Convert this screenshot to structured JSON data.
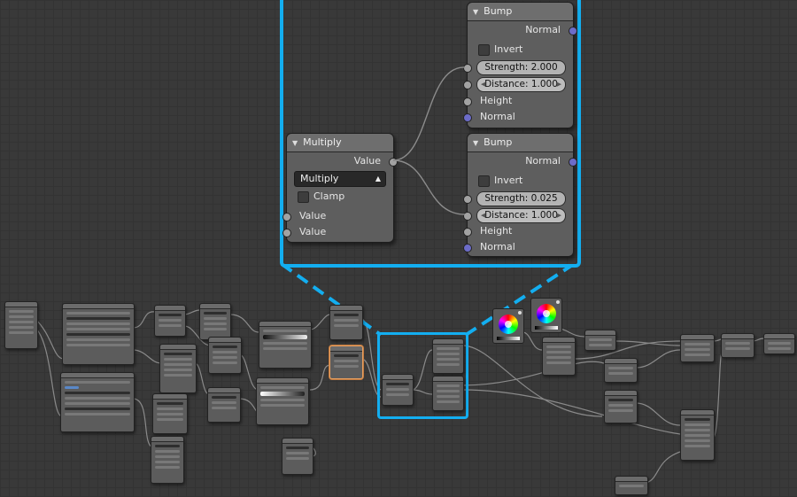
{
  "callout": {
    "multiply": {
      "title": "Multiply",
      "output": "Value",
      "operation": "Multiply",
      "clamp_label": "Clamp",
      "inputs": [
        "Value",
        "Value"
      ]
    },
    "bump_top": {
      "title": "Bump",
      "output": "Normal",
      "invert_label": "Invert",
      "strength": "Strength:  2.000",
      "distance": "Distance:  1.000",
      "height_label": "Height",
      "normal_label": "Normal"
    },
    "bump_bottom": {
      "title": "Bump",
      "output": "Normal",
      "invert_label": "Invert",
      "strength": "Strength:  0.025",
      "distance": "Distance:  1.000",
      "height_label": "Height",
      "normal_label": "Normal"
    }
  },
  "colors": {
    "highlight": "#13aef0",
    "selected_node": "#e8a060",
    "socket_float": "#a2a2a2",
    "socket_vector": "#6c6cc8",
    "wire": "#8c8c8c"
  },
  "icons": {
    "collapse": "disclosure-triangle-icon",
    "color_wheel": "color-wheel-icon"
  }
}
